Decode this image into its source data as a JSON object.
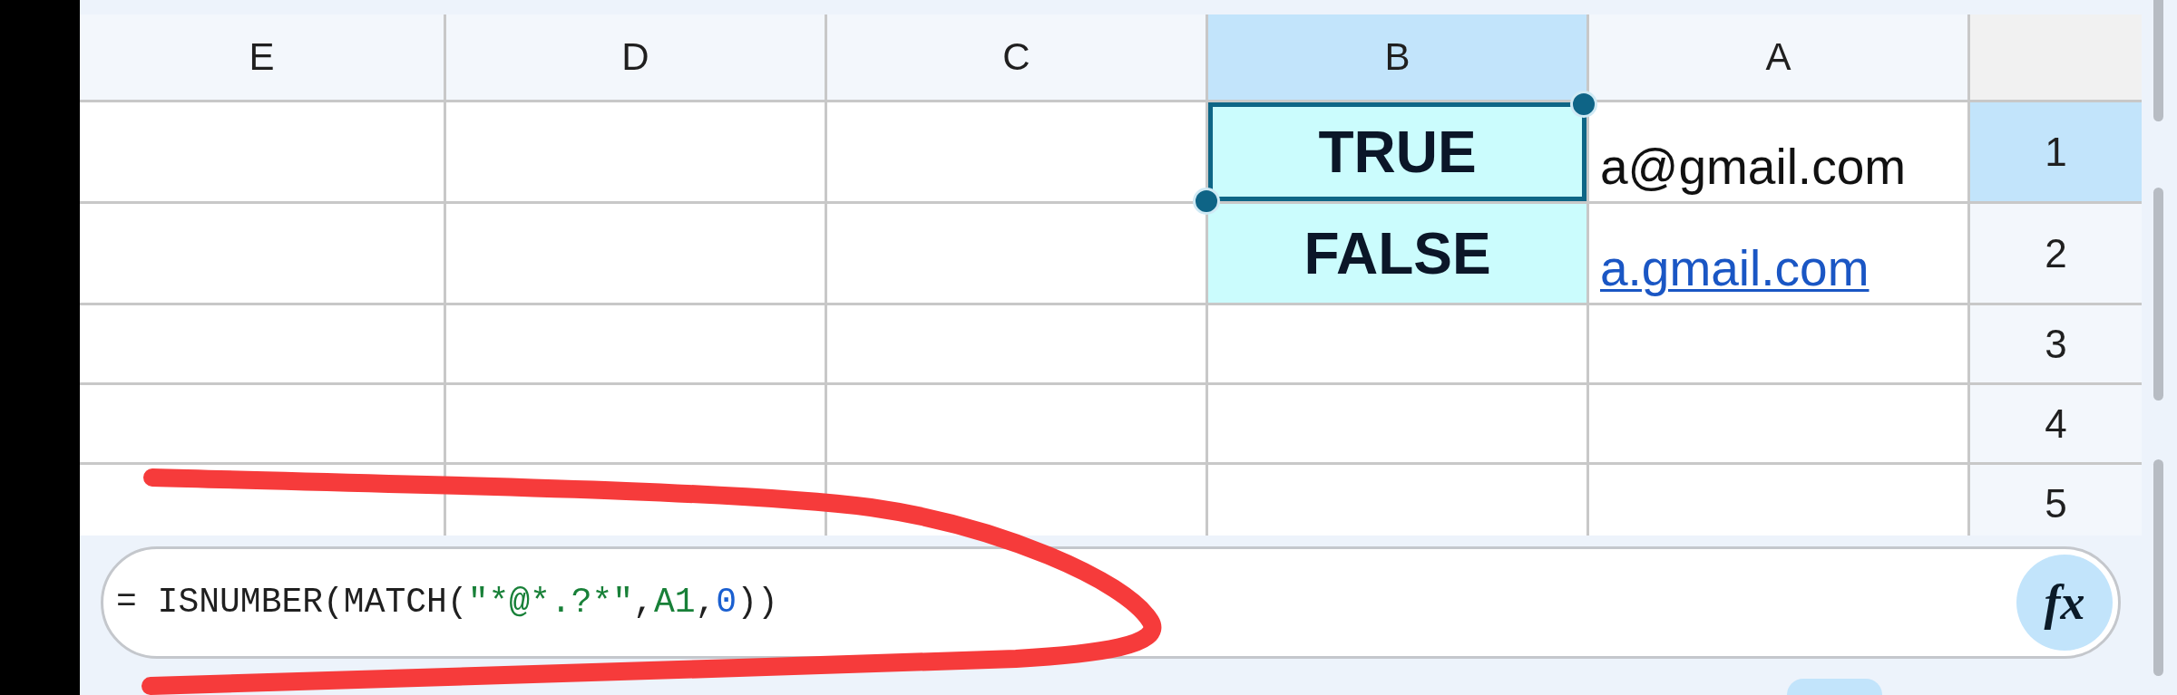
{
  "columns": [
    {
      "label": "E",
      "selected": false
    },
    {
      "label": "D",
      "selected": false
    },
    {
      "label": "C",
      "selected": false
    },
    {
      "label": "B",
      "selected": true
    },
    {
      "label": "A",
      "selected": false
    }
  ],
  "rows": [
    {
      "label": "1",
      "selected": true,
      "cells": [
        {
          "kind": "empty",
          "selected": false
        },
        {
          "kind": "empty",
          "selected": false
        },
        {
          "kind": "empty",
          "selected": false
        },
        {
          "kind": "boolean",
          "value": "TRUE",
          "color": "#cbfcfd",
          "selected": true
        },
        {
          "kind": "text",
          "value": "a@gmail.com",
          "selected": false
        }
      ]
    },
    {
      "label": "2",
      "selected": false,
      "cells": [
        {
          "kind": "empty",
          "selected": false
        },
        {
          "kind": "empty",
          "selected": false
        },
        {
          "kind": "empty",
          "selected": false
        },
        {
          "kind": "boolean",
          "value": "FALSE",
          "color": "#cbfcfd",
          "selected": false
        },
        {
          "kind": "link",
          "value": "a.gmail.com",
          "selected": false
        }
      ]
    },
    {
      "label": "3",
      "selected": false,
      "cells": [
        {
          "kind": "empty",
          "selected": false
        },
        {
          "kind": "empty",
          "selected": false
        },
        {
          "kind": "empty",
          "selected": false
        },
        {
          "kind": "empty",
          "selected": false
        },
        {
          "kind": "empty",
          "selected": false
        }
      ]
    },
    {
      "label": "4",
      "selected": false,
      "cells": [
        {
          "kind": "empty",
          "selected": false
        },
        {
          "kind": "empty",
          "selected": false
        },
        {
          "kind": "empty",
          "selected": false
        },
        {
          "kind": "empty",
          "selected": false
        },
        {
          "kind": "empty",
          "selected": false
        }
      ]
    },
    {
      "label": "5",
      "selected": false,
      "cells": [
        {
          "kind": "empty",
          "selected": false
        },
        {
          "kind": "empty",
          "selected": false
        },
        {
          "kind": "empty",
          "selected": false
        },
        {
          "kind": "empty",
          "selected": false
        },
        {
          "kind": "empty",
          "selected": false
        }
      ]
    }
  ],
  "formula_bar": {
    "tokens": [
      {
        "kind": "operator",
        "text": "= "
      },
      {
        "kind": "function",
        "text": "ISNUMBER("
      },
      {
        "kind": "function",
        "text": "MATCH("
      },
      {
        "kind": "string",
        "text": "\"*@*.?*\""
      },
      {
        "kind": "operator",
        "text": ","
      },
      {
        "kind": "reference",
        "text": "A1"
      },
      {
        "kind": "operator",
        "text": ","
      },
      {
        "kind": "number",
        "text": "0"
      },
      {
        "kind": "operator",
        "text": "))"
      }
    ],
    "button_label": "fx"
  }
}
